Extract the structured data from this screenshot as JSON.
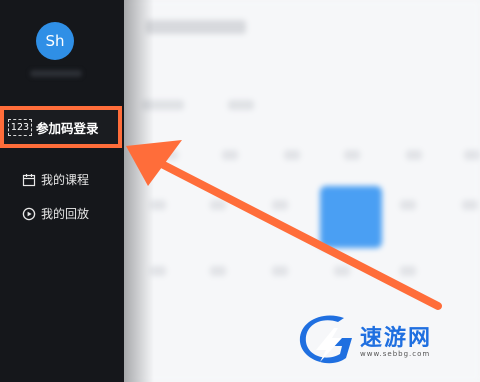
{
  "sidebar": {
    "avatar_text": "Sh",
    "code_login": {
      "icon_text": "123",
      "label": "参加码登录"
    },
    "items": [
      {
        "label": "我的课程",
        "icon": "calendar-icon"
      },
      {
        "label": "我的回放",
        "icon": "replay-icon"
      }
    ]
  },
  "colors": {
    "sidebar_bg": "#15171b",
    "accent_orange": "#ff6d3a",
    "avatar_blue": "#2f8fe6",
    "highlight_blue": "#4a9ff3"
  },
  "watermark": {
    "name": "速游网",
    "url": "www.sebbg.com"
  }
}
